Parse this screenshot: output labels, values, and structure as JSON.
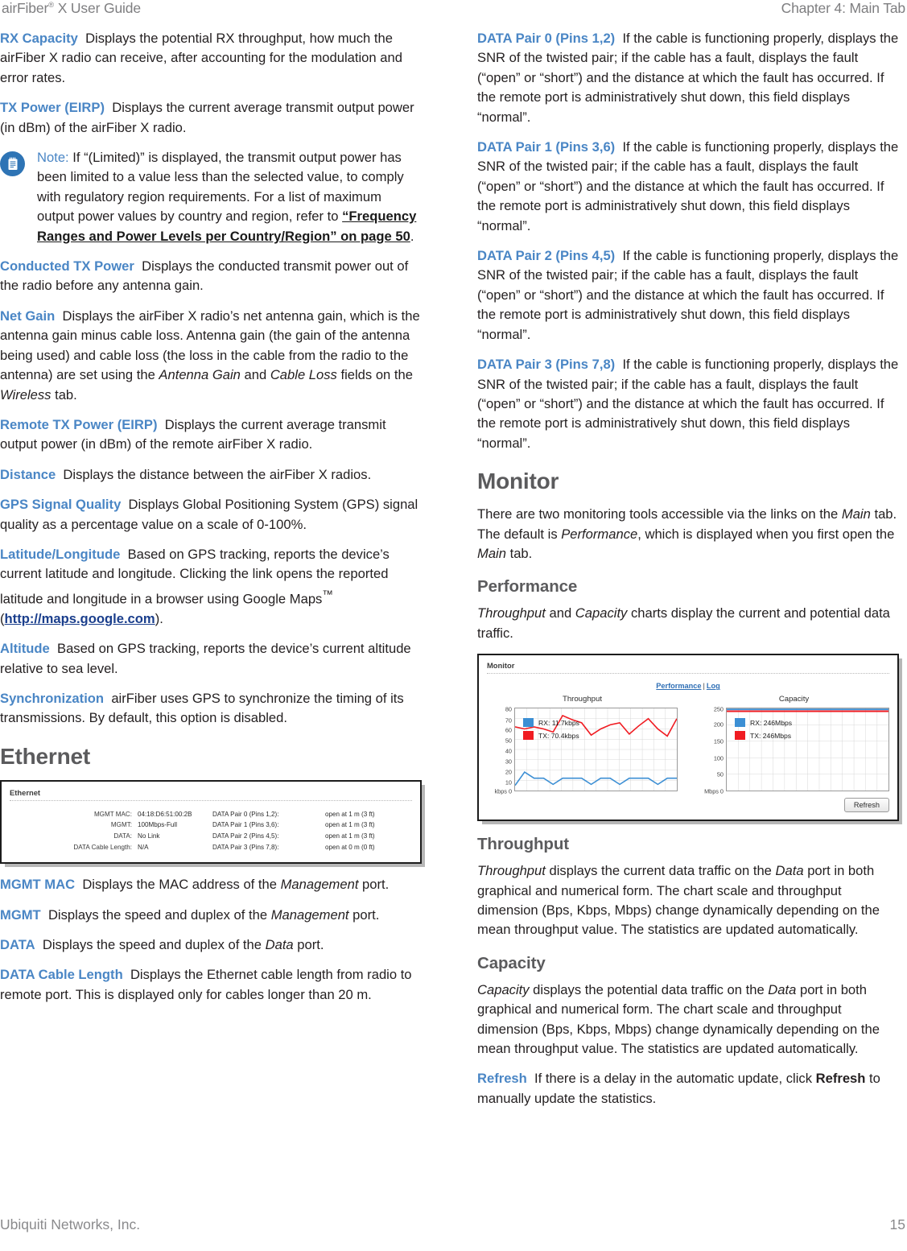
{
  "runhead": {
    "left_pre": "airFiber",
    "left_sup": "®",
    "left_post": " X User Guide",
    "right": "Chapter 4: Main Tab"
  },
  "footer": {
    "company": "Ubiquiti Networks, Inc.",
    "page_number": "15"
  },
  "colors": {
    "term_blue": "#4a86c5",
    "heading_gray": "#5b5b5d",
    "link_blue": "#1a3e8c",
    "rx_series": "#3c8fd4",
    "tx_series": "#f01c22",
    "note_icon_bg": "#2e74b5"
  },
  "left_column": {
    "entries": [
      {
        "term": "RX Capacity",
        "text": "Displays the potential RX throughput, how much the airFiber X radio can receive, after accounting for the modulation and error rates."
      },
      {
        "term": "TX Power (EIRP)",
        "text": "Displays the current average transmit output power (in dBm) of the airFiber X radio."
      }
    ],
    "note": {
      "icon": "note-document-icon",
      "label": "Note:",
      "text_before": " If “(Limited)” is displayed, the transmit output power has been limited to a value less than the selected value, to comply with regulatory region requirements. For a list of maximum output power values by country and region, refer to ",
      "xref": "“Frequency Ranges and Power Levels per Country/Region” on page 50",
      "text_after": "."
    },
    "entries2": [
      {
        "term": "Conducted TX Power",
        "text": "Displays the conducted transmit power out of the radio before any antenna gain."
      }
    ],
    "net_gain": {
      "term": "Net Gain",
      "p1": "Displays the airFiber X radio’s net antenna gain, which is the antenna gain minus cable loss. Antenna gain (the gain of the antenna being used) and cable loss (the loss in the cable from the radio to the antenna) are set using the ",
      "i1": "Antenna Gain",
      "p2": " and ",
      "i2": "Cable Loss",
      "p3": " fields on the ",
      "i3": "Wireless",
      "p4": " tab."
    },
    "entries3": [
      {
        "term": "Remote TX Power (EIRP)",
        "text": "Displays the current average transmit output power (in dBm) of the remote airFiber X radio."
      },
      {
        "term": "Distance",
        "text": "Displays the distance between the airFiber X radios."
      },
      {
        "term": "GPS Signal Quality",
        "text": "Displays Global Positioning System (GPS) signal quality as a percentage value on a scale of 0-100%."
      }
    ],
    "latlon": {
      "term": "Latitude/Longitude",
      "p1": "Based on GPS tracking, reports the device’s current latitude and longitude. Clicking the link opens the reported latitude and longitude in a browser using Google Maps",
      "tm": "™",
      "p2": " (",
      "link": "http://maps.google.com",
      "p3": ")."
    },
    "entries4": [
      {
        "term": "Altitude",
        "text": "Based on GPS tracking, reports the device’s current altitude relative to sea level."
      },
      {
        "term": "Synchronization",
        "text": "airFiber uses GPS to synchronize the timing of its transmissions. By default, this option is disabled."
      }
    ],
    "ethernet_heading": "Ethernet",
    "ethernet_panel": {
      "panel_title": "Ethernet",
      "left_fields": [
        {
          "label": "MGMT MAC:",
          "value": "04:18:D6:51:00:2B"
        },
        {
          "label": "MGMT:",
          "value": "100Mbps-Full"
        },
        {
          "label": "DATA:",
          "value": "No Link"
        },
        {
          "label": "DATA Cable Length:",
          "value": "N/A"
        }
      ],
      "right_fields": [
        {
          "label": "DATA Pair 0 (Pins 1,2):",
          "value": "open at 1 m (3 ft)"
        },
        {
          "label": "DATA Pair 1 (Pins 3,6):",
          "value": "open at 1 m (3 ft)"
        },
        {
          "label": "DATA Pair 2 (Pins 4,5):",
          "value": "open at 1 m (3 ft)"
        },
        {
          "label": "DATA Pair 3 (Pins 7,8):",
          "value": "open at 0 m (0 ft)"
        }
      ]
    },
    "mgmt_mac": {
      "term": "MGMT MAC",
      "p1": "Displays the MAC address of the ",
      "i1": "Management",
      "p2": " port."
    },
    "mgmt": {
      "term": "MGMT",
      "p1": "Displays the speed and duplex of the ",
      "i1": "Management",
      "p2": " port."
    },
    "data": {
      "term": "DATA",
      "p1": "Displays the speed and duplex of the ",
      "i1": "Data",
      "p2": " port."
    },
    "data_cable_length": {
      "term": "DATA Cable Length",
      "text": "Displays the Ethernet cable length from radio to remote port. This is displayed only for cables longer than 20 m."
    }
  },
  "right_column": {
    "data_pairs": [
      {
        "term": "DATA Pair 0 (Pins 1,2)",
        "text": "If the cable is functioning properly, displays the SNR of the twisted pair; if the cable has a fault, displays the fault (“open” or “short”) and the distance at which the fault has occurred. If the remote port is administratively shut down, this field displays “normal”."
      },
      {
        "term": "DATA Pair 1 (Pins 3,6)",
        "text": "If the cable is functioning properly, displays the SNR of the twisted pair; if the cable has a fault, displays the fault (“open” or “short”) and the distance at which the fault has occurred. If the remote port is administratively shut down, this field displays “normal”."
      },
      {
        "term": "DATA Pair 2 (Pins 4,5)",
        "text": "If the cable is functioning properly, displays the SNR of the twisted pair; if the cable has a fault, displays the fault (“open” or “short”) and the distance at which the fault has occurred. If the remote port is administratively shut down, this field displays “normal”."
      },
      {
        "term": "DATA Pair 3 (Pins 7,8)",
        "text": "If the cable is functioning properly, displays the SNR of the twisted pair; if the cable has a fault, displays the fault (“open” or “short”) and the distance at which the fault has occurred. If the remote port is administratively shut down, this field displays “normal”."
      }
    ],
    "monitor_heading": "Monitor",
    "monitor_intro": {
      "p1": "There are two monitoring tools accessible via the links on the ",
      "i1": "Main",
      "p2": " tab. The default is ",
      "i2": "Performance",
      "p3": ", which is displayed when you first open the ",
      "i3": "Main",
      "p4": " tab."
    },
    "performance_heading": "Performance",
    "performance_intro": {
      "i1": "Throughput",
      "p1": " and ",
      "i2": "Capacity",
      "p2": " charts display the current and potential data traffic."
    },
    "monitor_panel": {
      "panel_title": "Monitor",
      "link_performance": "Performance",
      "link_separator": "|",
      "link_log": "Log",
      "refresh_button": "Refresh"
    },
    "throughput_heading": "Throughput",
    "throughput_text": {
      "i1": "Throughput",
      "p1": " displays the current data traffic on the ",
      "i2": "Data",
      "p2": " port in both graphical and numerical form. The chart scale and throughput dimension (Bps, Kbps, Mbps) change dynamically depending on the mean throughput value. The statistics are updated automatically."
    },
    "capacity_heading": "Capacity",
    "capacity_text": {
      "i1": "Capacity",
      "p1": " displays the potential data traffic on the ",
      "i2": "Data",
      "p2": " port in both graphical and numerical form. The chart scale and throughput dimension (Bps, Kbps, Mbps) change dynamically depending on the mean throughput value. The statistics are updated automatically."
    },
    "refresh": {
      "term": "Refresh",
      "p1": "If there is a delay in the automatic update, click ",
      "b1": "Refresh",
      "p2": " to manually update the statistics."
    }
  },
  "chart_data": [
    {
      "type": "line",
      "title": "Throughput",
      "xlabel": "",
      "ylabel": "kbps",
      "ylim": [
        0,
        80
      ],
      "yticks": [
        0,
        10,
        20,
        30,
        40,
        50,
        60,
        70,
        80
      ],
      "ytick_labels": [
        "kbps 0",
        "10",
        "20",
        "30",
        "40",
        "50",
        "60",
        "70",
        "80"
      ],
      "grid": true,
      "legend_position": "top-left",
      "legend": [
        "RX: 11.7kbps",
        "TX: 70.4kbps"
      ],
      "series": [
        {
          "name": "RX: 11.7kbps",
          "color": "#3c8fd4",
          "values": [
            5,
            18,
            12,
            12,
            6,
            12,
            12,
            12,
            6,
            12,
            12,
            6,
            12,
            12,
            12,
            6,
            12,
            12
          ]
        },
        {
          "name": "TX: 70.4kbps",
          "color": "#f01c22",
          "values": [
            62,
            60,
            62,
            60,
            57,
            73,
            69,
            66,
            54,
            60,
            64,
            66,
            55,
            63,
            70,
            60,
            53,
            70
          ]
        }
      ]
    },
    {
      "type": "line",
      "title": "Capacity",
      "xlabel": "",
      "ylabel": "Mbps",
      "ylim": [
        0,
        250
      ],
      "yticks": [
        0,
        50,
        100,
        150,
        200,
        250
      ],
      "ytick_labels": [
        "Mbps 0",
        "50",
        "100",
        "150",
        "200",
        "250"
      ],
      "grid": true,
      "legend_position": "top-left",
      "legend": [
        "RX: 246Mbps",
        "TX: 246Mbps"
      ],
      "series": [
        {
          "name": "RX: 246Mbps",
          "color": "#3c8fd4",
          "values": [
            248,
            248,
            248,
            248,
            248,
            248,
            248,
            248,
            248,
            248,
            248,
            248,
            248,
            248,
            248,
            248,
            248,
            248
          ]
        },
        {
          "name": "TX: 246Mbps",
          "color": "#f01c22",
          "values": [
            244,
            244,
            244,
            244,
            244,
            244,
            244,
            244,
            244,
            244,
            244,
            244,
            244,
            244,
            244,
            244,
            244,
            244
          ]
        }
      ]
    }
  ]
}
